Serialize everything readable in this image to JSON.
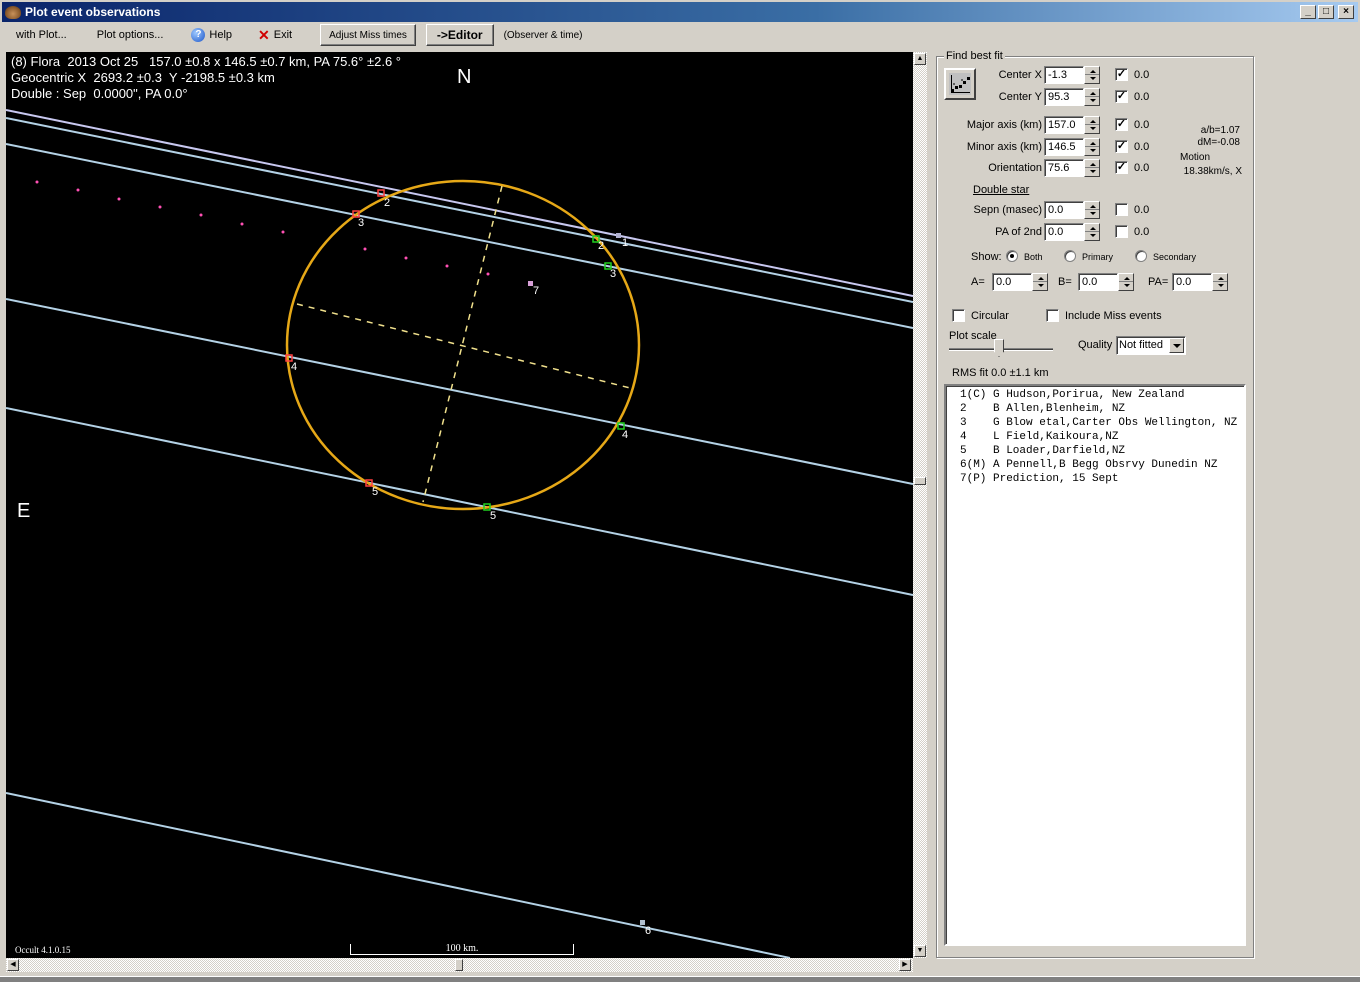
{
  "window": {
    "title": "Plot event observations",
    "controls": {
      "minimize": "_",
      "maximize": "□",
      "close": "×"
    }
  },
  "menubar": {
    "with_plot": "with Plot...",
    "plot_options": "Plot options...",
    "help": "Help",
    "exit": "Exit",
    "adjust_miss_times": "Adjust Miss times",
    "editor": "->Editor",
    "observer_time": "(Observer & time)"
  },
  "plot": {
    "header_line1": "(8) Flora  2013 Oct 25   157.0 ±0.8 x 146.5 ±0.7 km, PA 75.6° ±2.6 °",
    "header_line2": "Geocentric X  2693.2 ±0.3  Y -2198.5 ±0.3 km",
    "header_line3": "Double : Sep  0.0000\", PA 0.0°",
    "north_label": "N",
    "east_label": "E",
    "version": "Occult 4.1.0.15",
    "scale_label": "100 km.",
    "colors": {
      "background": "#000000",
      "ellipse": "#e6a817",
      "chord": "#b4d2e6",
      "chord_alt": "#c8c8f0",
      "axis": "#f0e08c",
      "disappear": "#ff4040",
      "reappear": "#20d020",
      "prediction": "#ff50b4"
    },
    "chord_labels": [
      {
        "id": "1",
        "text": "1"
      },
      {
        "id": "2a",
        "text": "2"
      },
      {
        "id": "2b",
        "text": "2"
      },
      {
        "id": "3a",
        "text": "3"
      },
      {
        "id": "3b",
        "text": "3"
      },
      {
        "id": "4a",
        "text": "4"
      },
      {
        "id": "4b",
        "text": "4"
      },
      {
        "id": "5a",
        "text": "5"
      },
      {
        "id": "5b",
        "text": "5"
      },
      {
        "id": "6",
        "text": "6"
      },
      {
        "id": "7",
        "text": "7"
      }
    ]
  },
  "panel": {
    "group_title": "Find best fit",
    "fit_rows": [
      {
        "label": "Center X",
        "value": "-1.3",
        "checked": true,
        "delta": "0.0"
      },
      {
        "label": "Center Y",
        "value": "95.3",
        "checked": true,
        "delta": "0.0"
      },
      {
        "label": "Major axis (km)",
        "value": "157.0",
        "checked": true,
        "delta": "0.0"
      },
      {
        "label": "Minor axis (km)",
        "value": "146.5",
        "checked": true,
        "delta": "0.0"
      },
      {
        "label": "Orientation",
        "value": "75.6",
        "checked": true,
        "delta": "0.0"
      }
    ],
    "ratio_ab": "a/b=1.07",
    "dm": "dM=-0.08",
    "motion_label": "Motion",
    "motion_value": "18.38km/s, X",
    "double_star_title": "Double star",
    "double_rows": [
      {
        "label": "Sepn (masec)",
        "value": "0.0",
        "checked": false,
        "delta": "0.0"
      },
      {
        "label": "PA of 2nd",
        "value": "0.0",
        "checked": false,
        "delta": "0.0"
      }
    ],
    "show_label": "Show:",
    "show_options": [
      {
        "label": "Both",
        "selected": true
      },
      {
        "label": "Primary",
        "selected": false
      },
      {
        "label": "Secondary",
        "selected": false
      }
    ],
    "a_label": "A=",
    "a_value": "0.0",
    "b_label": "B=",
    "b_value": "0.0",
    "pa_label": "PA=",
    "pa_value": "0.0",
    "circular_label": "Circular",
    "circular_checked": false,
    "include_miss_label": "Include Miss events",
    "include_miss_checked": false,
    "plot_scale_label": "Plot scale",
    "plot_scale_value": 0.5,
    "quality_label": "Quality",
    "quality_value": "Not fitted",
    "rms_fit": "RMS fit 0.0 ±1.1 km",
    "observers": [
      "1(C) G Hudson,Porirua, New Zealand",
      "2    B Allen,Blenheim, NZ",
      "3    G Blow etal,Carter Obs Wellington, NZ",
      "4    L Field,Kaikoura,NZ",
      "5    B Loader,Darfield,NZ",
      "6(M) A Pennell,B Begg Obsrvy Dunedin NZ",
      "7(P) Prediction, 15 Sept"
    ]
  }
}
